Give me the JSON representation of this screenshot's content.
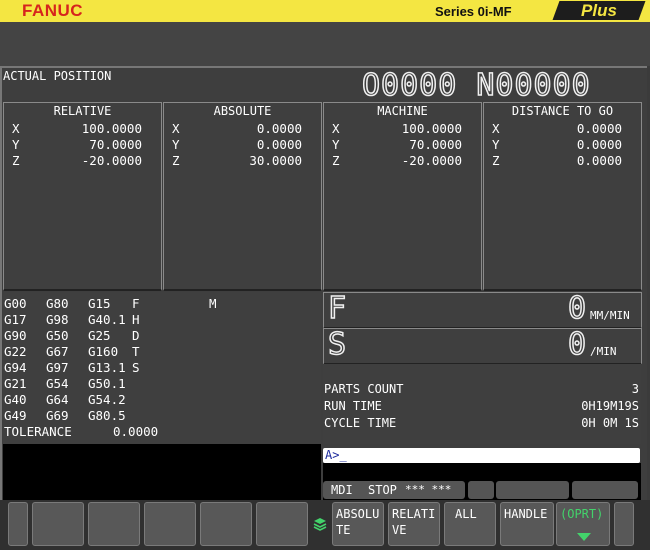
{
  "header": {
    "brand": "FANUC",
    "series": "Series 0i-MF",
    "plus": "Plus"
  },
  "screen_title": "ACTUAL POSITION",
  "program": "O0000 N00000",
  "panels": [
    {
      "title": "RELATIVE",
      "rows": [
        {
          "axis": "X",
          "value": "100.0000"
        },
        {
          "axis": "Y",
          "value": "70.0000"
        },
        {
          "axis": "Z",
          "value": "-20.0000"
        }
      ]
    },
    {
      "title": "ABSOLUTE",
      "rows": [
        {
          "axis": "X",
          "value": "0.0000"
        },
        {
          "axis": "Y",
          "value": "0.0000"
        },
        {
          "axis": "Z",
          "value": "30.0000"
        }
      ]
    },
    {
      "title": "MACHINE",
      "rows": [
        {
          "axis": "X",
          "value": "100.0000"
        },
        {
          "axis": "Y",
          "value": "70.0000"
        },
        {
          "axis": "Z",
          "value": "-20.0000"
        }
      ]
    },
    {
      "title": "DISTANCE TO GO",
      "rows": [
        {
          "axis": "X",
          "value": "0.0000"
        },
        {
          "axis": "Y",
          "value": "0.0000"
        },
        {
          "axis": "Z",
          "value": "0.0000"
        }
      ]
    }
  ],
  "gcodes": {
    "col1": [
      "G00",
      "G17",
      "G90",
      "G22",
      "G94",
      "G21",
      "G40",
      "G49"
    ],
    "col2": [
      "G80",
      "G98",
      "G50",
      "G67",
      "G97",
      "G54",
      "G64",
      "G69"
    ],
    "col3": [
      "G15",
      "G40.1",
      "G25",
      "G160",
      "G13.1",
      "G50.1",
      "G54.2",
      "G80.5"
    ],
    "col4": [
      "F",
      "H",
      "D",
      "T",
      "S"
    ],
    "m_label": "M",
    "tolerance_label": "TOLERANCE",
    "tolerance_value": "0.0000"
  },
  "feed": {
    "label": "F",
    "value": "0",
    "unit": "MM/MIN"
  },
  "spindle": {
    "label": "S",
    "value": "0",
    "unit": "/MIN"
  },
  "counts": {
    "parts_label": "PARTS COUNT",
    "parts_value": "3",
    "run_label": "RUN TIME",
    "run_value": "0H19M19S",
    "cycle_label": "CYCLE TIME",
    "cycle_value": "0H 0M 1S"
  },
  "input": {
    "prompt": "A>_"
  },
  "status": {
    "mode": "MDI",
    "state": "STOP",
    "extra": "*** ***"
  },
  "softkeys": {
    "absolute": "ABSOLU\nTE",
    "relative": "RELATI\nVE",
    "all": "ALL",
    "handle": "HANDLE",
    "oprt": "(OPRT)"
  },
  "colors": {
    "header_bg": "#f4e642",
    "brand": "#d6241d",
    "oprt": "#43d36b"
  }
}
